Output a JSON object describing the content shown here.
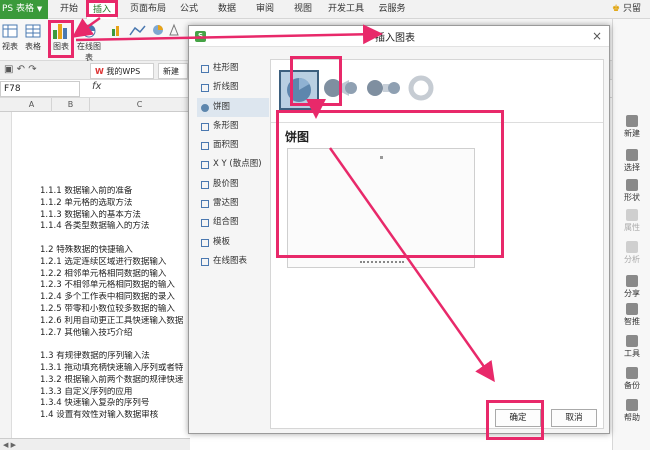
{
  "menubar": {
    "app_label": "PS 表格",
    "tabs": [
      "开始",
      "插入",
      "页面布局",
      "公式",
      "数据",
      "审阅",
      "视图",
      "开发工具",
      "云服务"
    ],
    "active_tab": "插入",
    "login": "只留"
  },
  "toolbar": {
    "pivot_label": "视表",
    "table_label": "表格",
    "chart_label": "图表",
    "online_chart_label": "在线图表"
  },
  "doc_tabs": {
    "my_wps": "我的WPS",
    "new_doc": "新建"
  },
  "formula_bar": {
    "cell_ref": "F78",
    "fx": "fx"
  },
  "sheet": {
    "columns": [
      "A",
      "B",
      "C"
    ],
    "lines": [
      "1.1.1 数据输入前的准备",
      "1.1.2 单元格的选取方法",
      "1.1.3 数据输入的基本方法",
      "1.1.4 各类型数据输入的方法",
      "",
      "1.2 特殊数据的快捷输入",
      "1.2.1 选定连续区域进行数据输入",
      "1.2.2 相邻单元格相同数据的输入",
      "1.2.3 不相邻单元格相同数据的输入",
      "1.2.4 多个工作表中相同数据的录入",
      "1.2.5 带零和小数位较多数据的输入",
      "1.2.6 利用自动更正工具快速输入数据",
      "1.2.7 其他输入技巧介绍",
      "",
      "1.3 有规律数据的序列输入法",
      "1.3.1 拖动填充柄快速输入序列或者特",
      "1.3.2 根据输入前两个数据的规律快速",
      "1.3.3 自定义序列的应用",
      "1.3.4 快速输入复杂的序列号",
      "1.4 设置有效性对输入数据审核"
    ]
  },
  "side_pane": {
    "items": [
      "新建",
      "选择",
      "形状",
      "属性",
      "分析",
      "分享",
      "智推",
      "工具",
      "备份",
      "帮助"
    ]
  },
  "dialog": {
    "title": "插入图表",
    "close": "×",
    "types": [
      "柱形图",
      "折线图",
      "饼图",
      "条形图",
      "面积图",
      "X Y (散点图)",
      "股价图",
      "雷达图",
      "组合图",
      "模板",
      "在线图表"
    ],
    "active_type": "饼图",
    "preview_title": "饼图",
    "ok_label": "确定",
    "cancel_label": "取消"
  },
  "colors": {
    "annotation": "#e8296a",
    "brand_green": "#3a9a3a",
    "selected_type_bg": "#dde6ef"
  }
}
